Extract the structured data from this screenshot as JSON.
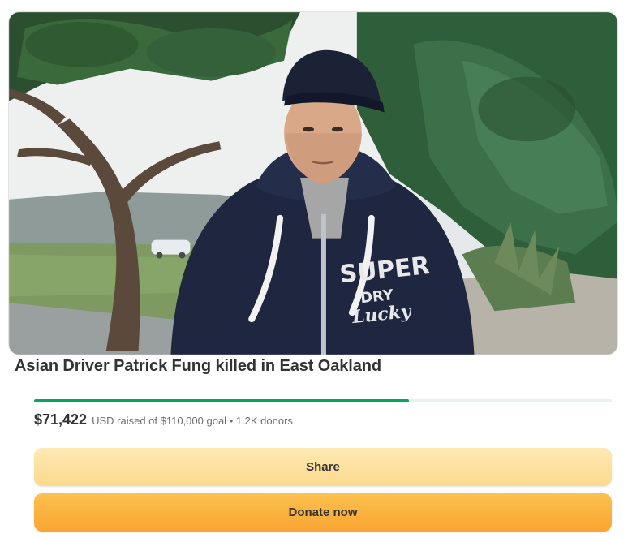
{
  "campaign": {
    "title": "Asian Driver Patrick Fung killed in East Oakland",
    "photo_alt": "Patrick Fung photo"
  },
  "progress": {
    "fraction": 0.6493,
    "color": "#02a95c",
    "track_color": "#e5f3ec"
  },
  "stats": {
    "amount": "$71,422",
    "detail": "USD raised of $110,000 goal • 1.2K donors"
  },
  "actions": {
    "share_label": "Share",
    "donate_label": "Donate now"
  }
}
